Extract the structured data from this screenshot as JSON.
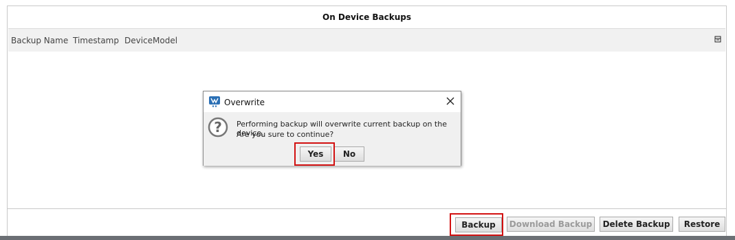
{
  "panel": {
    "title": "On Device Backups",
    "columns": [
      "Backup Name",
      "Timestamp",
      "DeviceModel"
    ]
  },
  "toolbar": {
    "backup_label": "Backup",
    "download_label": "Download Backup",
    "delete_label": "Delete Backup",
    "restore_label": "Restore"
  },
  "dialog": {
    "title": "Overwrite",
    "message_line1": "Performing backup will overwrite current backup on the device.",
    "message_line2": "Are you sure to continue?",
    "yes_label": "Yes",
    "no_label": "No"
  },
  "colors": {
    "highlight": "#d21010",
    "logo_blue": "#2a6fb5"
  }
}
